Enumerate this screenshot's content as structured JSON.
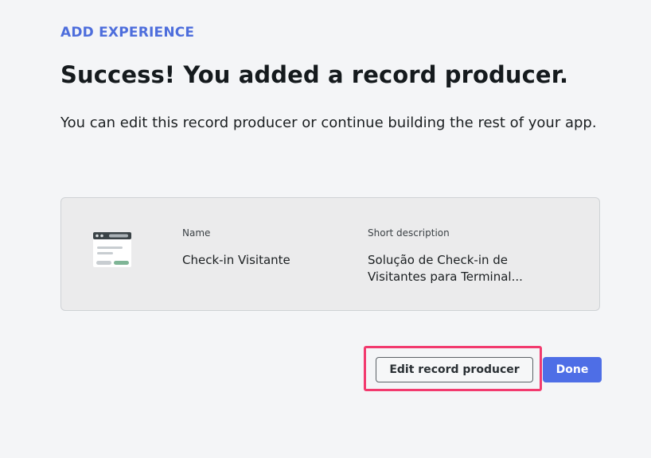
{
  "header": {
    "eyebrow": "ADD EXPERIENCE",
    "title": "Success! You added a record producer.",
    "subtitle": "You can edit this record producer or continue building the rest of your app."
  },
  "card": {
    "icon": "form-window-icon",
    "name_label": "Name",
    "name_value": "Check-in Visitante",
    "desc_label": "Short description",
    "desc_value": "Solução de Check-in de Visitantes para Terminal..."
  },
  "actions": {
    "edit_label": "Edit record producer",
    "done_label": "Done"
  },
  "colors": {
    "accent": "#4e6ee6",
    "highlight": "#f23a6e",
    "background": "#f4f5f7"
  }
}
